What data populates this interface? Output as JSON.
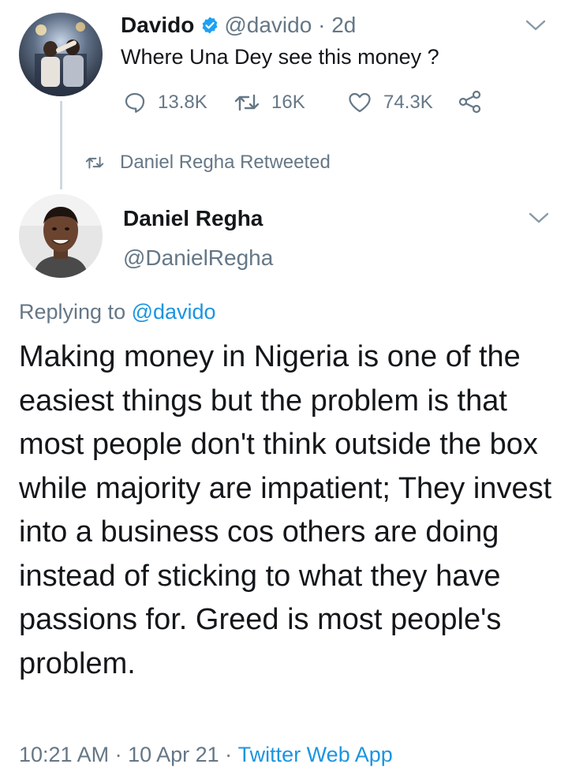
{
  "colors": {
    "text": "#14171a",
    "muted": "#657786",
    "link": "#1b95e0",
    "verified": "#1da1f2",
    "thread_line": "#cfd9de"
  },
  "original_tweet": {
    "name": "Davido",
    "handle": "@davido",
    "separator": " · ",
    "age": "2d",
    "text": "Where Una Dey see this money ?",
    "verified_icon": "verified-badge-icon",
    "actions": {
      "replies": "13.8K",
      "retweets": "16K",
      "likes": "74.3K"
    }
  },
  "retweet_context": {
    "label": "Daniel Regha Retweeted",
    "icon": "retweet-icon"
  },
  "main_tweet": {
    "name": "Daniel Regha",
    "handle": "@DanielRegha",
    "replying_prefix": "Replying to ",
    "replying_handle": "@davido",
    "text": "Making money in Nigeria is one of the easiest things but the problem is that most people don't think outside the box while majority are impatient; They invest into a business cos others are doing instead of sticking to what they have passions for. Greed is most people's problem.",
    "time": "10:21 AM",
    "date": "10 Apr 21",
    "separator": " · ",
    "source": "Twitter Web App"
  }
}
